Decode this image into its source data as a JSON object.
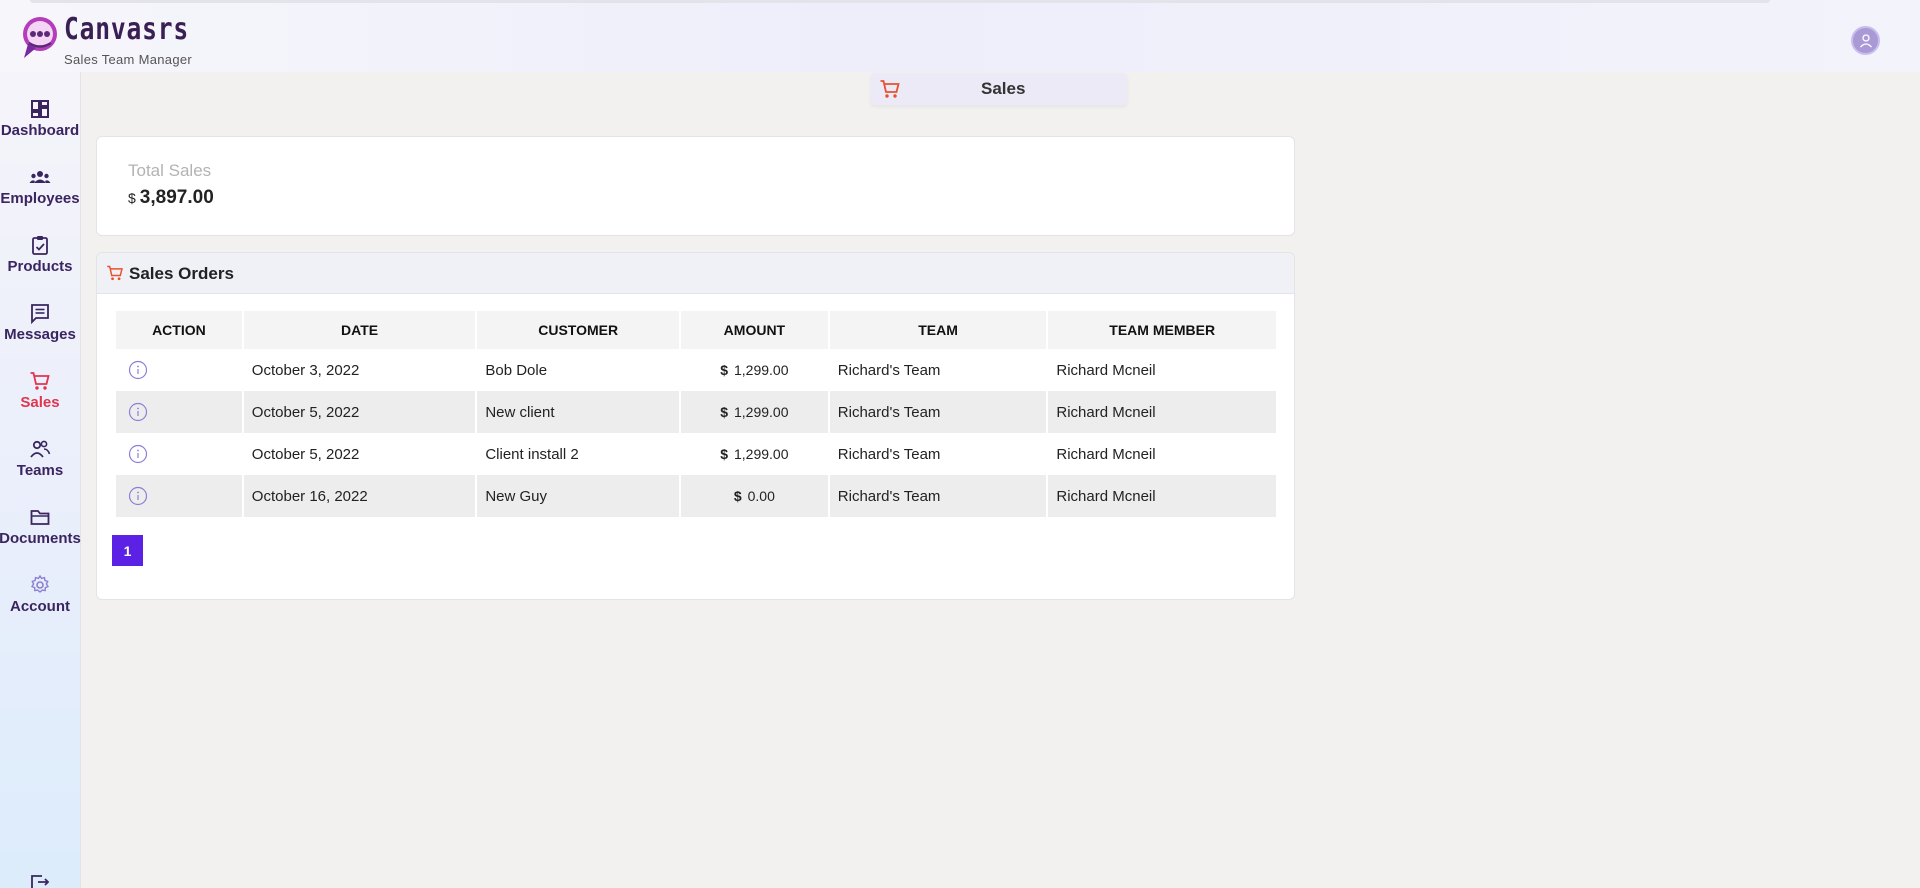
{
  "brand": {
    "name": "Canvasrs",
    "subtitle": "Sales Team Manager"
  },
  "sidebar": {
    "items": [
      {
        "label": "Dashboard",
        "icon": "dashboard-icon"
      },
      {
        "label": "Employees",
        "icon": "employees-icon"
      },
      {
        "label": "Products",
        "icon": "clipboard-check-icon"
      },
      {
        "label": "Messages",
        "icon": "message-icon"
      },
      {
        "label": "Sales",
        "icon": "cart-icon",
        "active": true
      },
      {
        "label": "Teams",
        "icon": "users-icon"
      },
      {
        "label": "Documents",
        "icon": "folder-icon"
      },
      {
        "label": "Account",
        "icon": "gear-icon"
      }
    ],
    "active_color": "#e0344f",
    "label_color": "#3b2560"
  },
  "page": {
    "title": "Sales"
  },
  "totals": {
    "label": "Total Sales",
    "currency": "$",
    "value": "3,897.00"
  },
  "orders": {
    "title": "Sales Orders",
    "columns": [
      "ACTION",
      "DATE",
      "CUSTOMER",
      "AMOUNT",
      "TEAM",
      "TEAM MEMBER"
    ],
    "rows": [
      {
        "date": "October 3, 2022",
        "customer": "Bob Dole",
        "currency": "$",
        "amount": "1,299.00",
        "team": "Richard's Team",
        "member": "Richard Mcneil"
      },
      {
        "date": "October 5, 2022",
        "customer": "New client",
        "currency": "$",
        "amount": "1,299.00",
        "team": "Richard's Team",
        "member": "Richard Mcneil"
      },
      {
        "date": "October 5, 2022",
        "customer": "Client install 2",
        "currency": "$",
        "amount": "1,299.00",
        "team": "Richard's Team",
        "member": "Richard Mcneil"
      },
      {
        "date": "October 16, 2022",
        "customer": "New Guy",
        "currency": "$",
        "amount": "0.00",
        "team": "Richard's Team",
        "member": "Richard Mcneil"
      }
    ]
  },
  "pagination": {
    "current_page": "1"
  },
  "colors": {
    "accent": "#5b22e6",
    "cart_icon": "#e8512e",
    "brand": "#3a1f55"
  }
}
